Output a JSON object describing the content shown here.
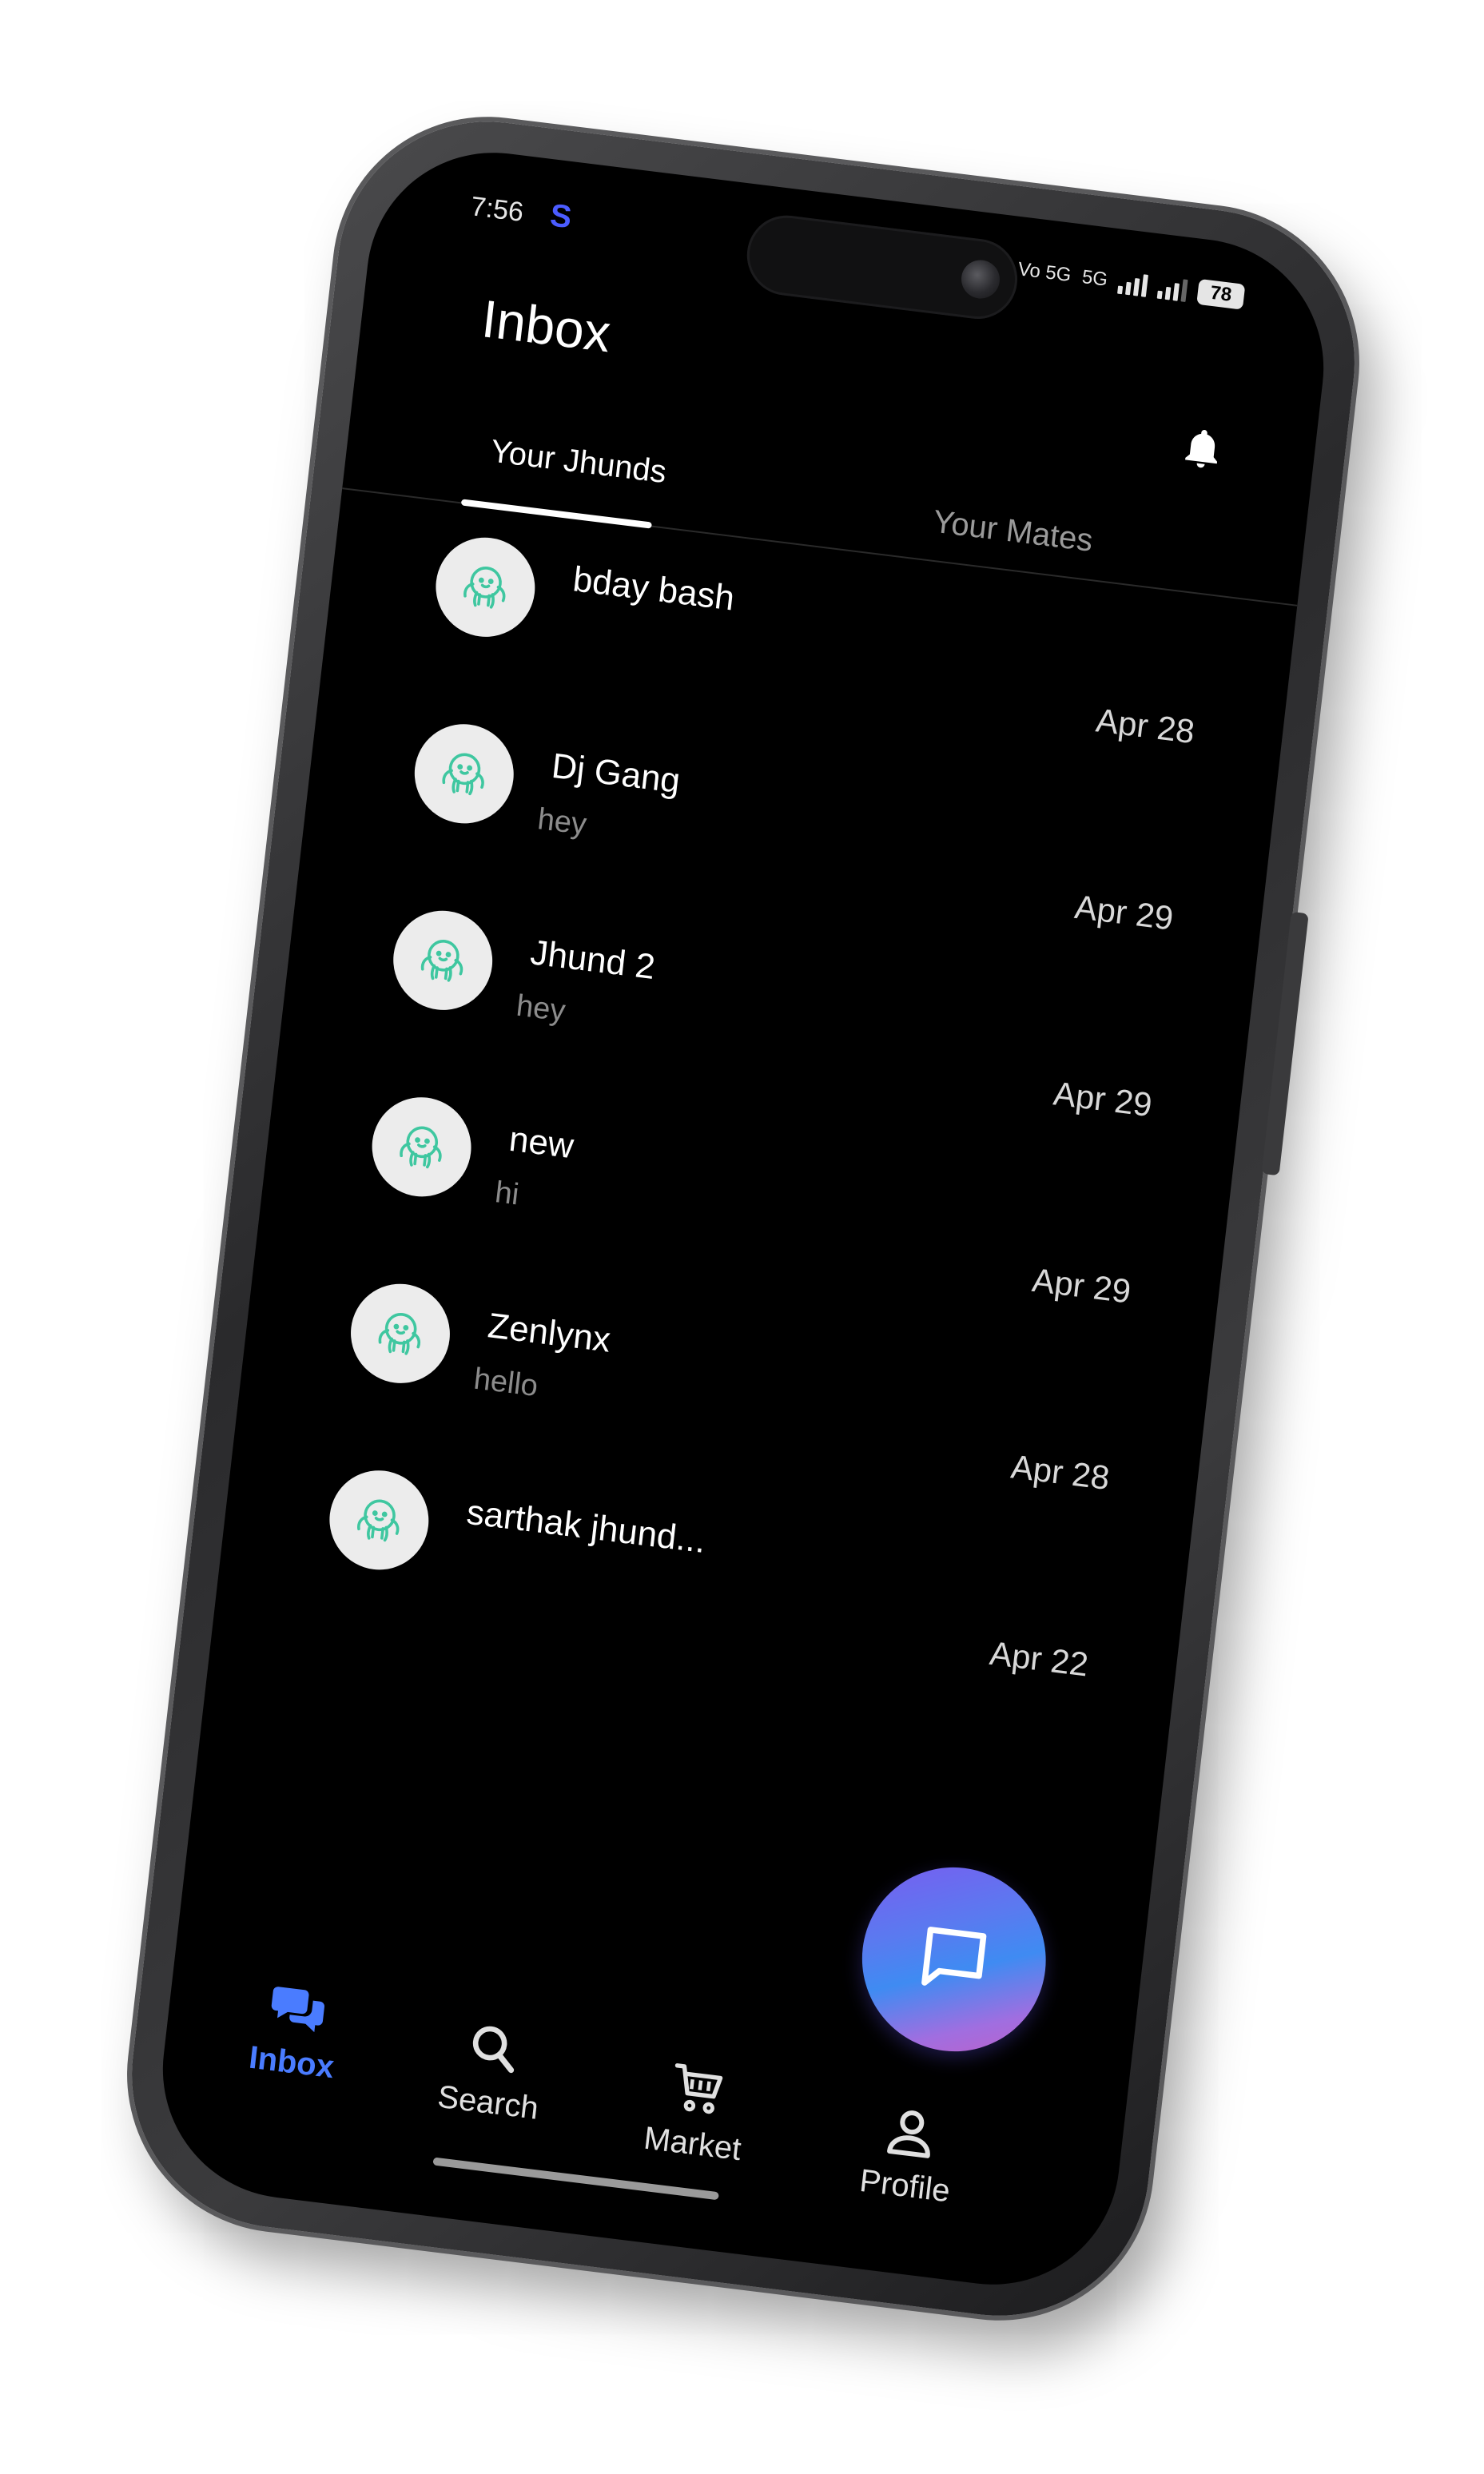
{
  "status_bar": {
    "time": "7:56",
    "app_indicator": "S",
    "network_label": "Vo 5G",
    "net_5g": "5G",
    "battery": "78"
  },
  "header": {
    "title": "Inbox",
    "notification_icon": "bell-icon"
  },
  "tabs": [
    {
      "label": "Your Jhunds",
      "active": true
    },
    {
      "label": "Your Mates",
      "active": false
    }
  ],
  "conversations": [
    {
      "name": "bday bash",
      "preview": "",
      "date": "Apr 28",
      "avatar_icon": "jhund-avatar-icon"
    },
    {
      "name": "Dj Gang",
      "preview": "hey",
      "date": "Apr 29",
      "avatar_icon": "jhund-avatar-icon"
    },
    {
      "name": "Jhund 2",
      "preview": "hey",
      "date": "Apr 29",
      "avatar_icon": "jhund-avatar-icon"
    },
    {
      "name": "new",
      "preview": "hi",
      "date": "Apr 29",
      "avatar_icon": "jhund-avatar-icon"
    },
    {
      "name": "Zenlynx",
      "preview": "hello",
      "date": "Apr 28",
      "avatar_icon": "jhund-avatar-icon"
    },
    {
      "name": "sarthak jhund...",
      "preview": "",
      "date": "Apr 22",
      "avatar_icon": "jhund-avatar-icon"
    }
  ],
  "fab": {
    "icon": "new-chat-icon"
  },
  "bottom_nav": [
    {
      "label": "Inbox",
      "icon": "chat-bubbles-icon",
      "active": true
    },
    {
      "label": "Search",
      "icon": "search-icon",
      "active": false
    },
    {
      "label": "Market",
      "icon": "cart-icon",
      "active": false
    },
    {
      "label": "Profile",
      "icon": "person-icon",
      "active": false
    }
  ],
  "colors": {
    "background": "#000000",
    "accent": "#4a7cff",
    "status_s": "#4b5cff",
    "avatar_bg": "#ececec",
    "avatar_icon": "#3fc7a0",
    "fab_gradient_start": "#7a5cf0",
    "fab_gradient_end": "#c060c8"
  }
}
